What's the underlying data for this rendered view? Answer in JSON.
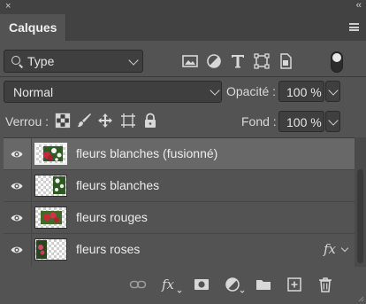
{
  "panel": {
    "title": "Calques",
    "close_glyph": "×",
    "collapse_glyph": "‹‹"
  },
  "filter": {
    "kind_label": "Type",
    "icons": [
      "image-filter-icon",
      "adjustment-filter-icon",
      "type-filter-icon",
      "shape-filter-icon",
      "smart-object-filter-icon"
    ]
  },
  "blend": {
    "mode": "Normal",
    "opacity_label": "Opacité :",
    "opacity_value": "100 %"
  },
  "lock": {
    "label": "Verrou :",
    "fill_label": "Fond :",
    "fill_value": "100 %"
  },
  "layers": [
    {
      "name": "fleurs blanches (fusionné)",
      "selected": true,
      "fx": false
    },
    {
      "name": "fleurs blanches",
      "selected": false,
      "fx": false
    },
    {
      "name": "fleurs rouges",
      "selected": false,
      "fx": false
    },
    {
      "name": "fleurs roses",
      "selected": false,
      "fx": true
    }
  ],
  "fx_label": "fx",
  "colors": {
    "panel_bg": "#535353",
    "selected_row": "#686868",
    "field_bg": "#3f3f3f"
  }
}
